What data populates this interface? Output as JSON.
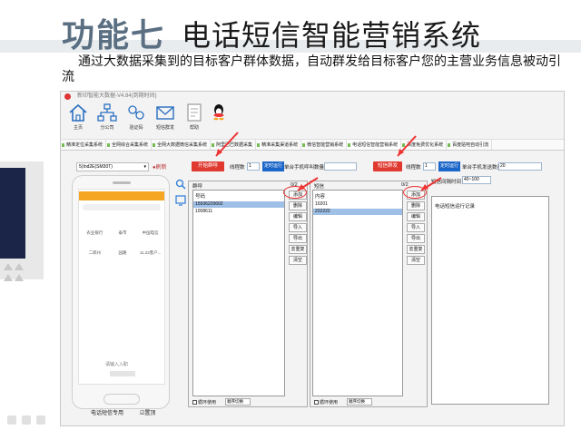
{
  "slide": {
    "title_num": "功能七",
    "title_text": "电话短信智能营销系统",
    "description": "通过大数据采集到的目标客户群体数据，自动群发给目标客户您的主营业务信息被动引流"
  },
  "app": {
    "window_title": "新印智能大数据-V4.84(到期时间)",
    "toolbar": [
      {
        "label": "主页",
        "icon": "home-icon"
      },
      {
        "label": "分公司",
        "icon": "org-icon"
      },
      {
        "label": "验证码",
        "icon": "code-icon"
      },
      {
        "label": "短信群发",
        "icon": "mail-icon"
      },
      {
        "label": "帮助",
        "icon": "help-icon"
      }
    ],
    "tabs": [
      "精准定位采集系统",
      "全网综合采集系统",
      "全网大数据微信采集系统",
      "阿里巴巴数据采集",
      "精准采集渠道系统",
      "微信智能营销系统",
      "电话短信智能营销系统",
      "百度免费优化系统",
      "百度贴吧自动引流"
    ],
    "active_tab_index": 6,
    "phone": {
      "device_select": "5(Ind2E(SM30T)",
      "refresh_label": "刷新",
      "screen_rows": [
        [
          "农业银行",
          "泰市",
          "中国电信"
        ],
        [
          "二郎州",
          "园路",
          "11.22客户..."
        ]
      ],
      "footer_text": "请输入入职",
      "caption": "电话短信专用",
      "check_label": "置顶"
    },
    "call": {
      "start_button": "开始群呼",
      "thread_label": "线程数",
      "thread_value": "1",
      "timer_button": "定时运行",
      "per_phone_label": "单台手机呼叫数量",
      "per_phone_value": "",
      "list_title": "群呼",
      "count": "0/2",
      "column_label": "号码",
      "numbers": [
        "15936220602",
        "1008611"
      ],
      "selected_index": 0,
      "loop_label": "循环使用",
      "order_label": "顺序切换"
    },
    "sms": {
      "start_button": "短信群发",
      "thread_label": "线程数",
      "thread_value": "1",
      "timer_button": "定时运行",
      "per_phone_label": "单台手机发送数量",
      "per_phone_value": "20",
      "interval_label": "短信间隔时间",
      "interval_value": "40~100",
      "list_title": "短信",
      "count": "0/2",
      "column_label": "内容",
      "contents": [
        "10201",
        "222222"
      ],
      "selected_index": 1,
      "loop_label": "循环使用",
      "order_label": "顺序切换"
    },
    "side_buttons": [
      "添加",
      "删除",
      "编辑",
      "导入",
      "导出",
      "去重复",
      "清空"
    ],
    "log_title": "电话短信运行记录"
  }
}
